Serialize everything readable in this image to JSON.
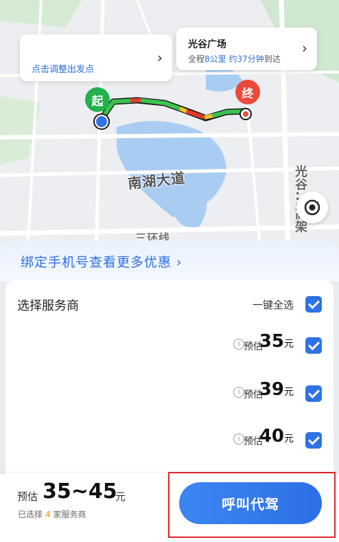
{
  "map": {
    "start_card": {
      "text": "点击调整出发点",
      "chevron": "›"
    },
    "dest_card": {
      "name": "光谷广场",
      "distance_prefix": "全程",
      "distance": "8公里",
      "time": "约37分钟",
      "time_suffix": "到达",
      "chevron": "›"
    },
    "start_pin": "起",
    "end_pin": "终",
    "labels": {
      "lake_road": "南湖大道",
      "ring": "三环线",
      "vertical": "光谷...高架"
    },
    "locate_icon": "target-icon"
  },
  "promo": {
    "text": "绑定手机号查看更多优惠 ›"
  },
  "panel": {
    "title": "选择服务商",
    "select_all": "一键全选",
    "providers": [
      {
        "est": "预估",
        "price": "35",
        "unit": "元",
        "checked": true
      },
      {
        "est": "预估",
        "price": "39",
        "unit": "元",
        "checked": true
      },
      {
        "est": "预估",
        "price": "40",
        "unit": "元",
        "checked": true
      }
    ]
  },
  "footer": {
    "est_label": "预估",
    "range": "35~45",
    "unit": "元",
    "selected_prefix": "已选择",
    "selected_count": "4",
    "selected_suffix": "家服务商",
    "call_button": "呼叫代驾"
  },
  "colors": {
    "accent": "#2f72e6",
    "start_pin": "#22b14c",
    "end_pin": "#ea4b3b",
    "highlight": "#e0242b"
  }
}
